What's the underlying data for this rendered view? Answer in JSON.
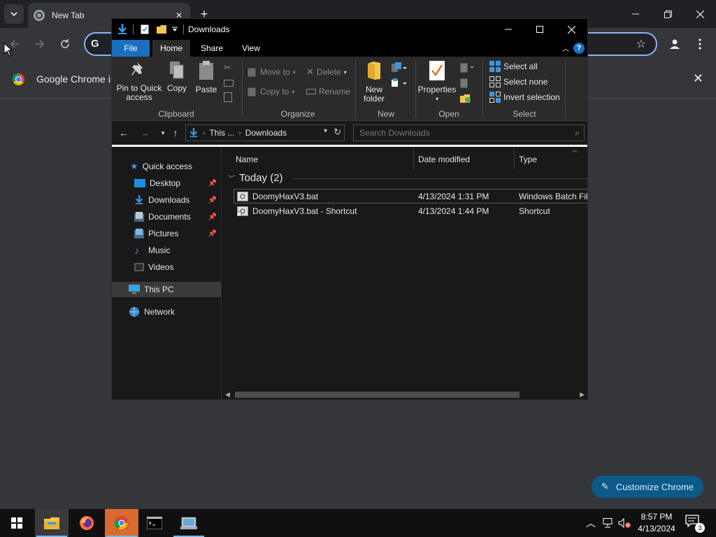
{
  "chrome": {
    "tab_title": "New Tab",
    "infobar_message": "Google Chrome isn",
    "customize_label": "Customize Chrome"
  },
  "explorer": {
    "title": "Downloads",
    "ribbon_tabs": [
      "File",
      "Home",
      "Share",
      "View"
    ],
    "clipboard": {
      "pin": "Pin to Quick access",
      "copy": "Copy",
      "paste": "Paste",
      "group": "Clipboard"
    },
    "organize": {
      "move_to": "Move to",
      "copy_to": "Copy to",
      "delete": "Delete",
      "rename": "Rename",
      "group": "Organize"
    },
    "new": {
      "new_folder": "New folder",
      "group": "New"
    },
    "open": {
      "properties": "Properties",
      "group": "Open"
    },
    "select": {
      "select_all": "Select all",
      "select_none": "Select none",
      "invert": "Invert selection",
      "group": "Select"
    },
    "address": {
      "crumb1": "This ...",
      "crumb2": "Downloads"
    },
    "search_placeholder": "Search Downloads",
    "nav": {
      "quick_access": "Quick access",
      "desktop": "Desktop",
      "downloads": "Downloads",
      "documents": "Documents",
      "pictures": "Pictures",
      "music": "Music",
      "videos": "Videos",
      "this_pc": "This PC",
      "network": "Network"
    },
    "columns": {
      "name": "Name",
      "date": "Date modified",
      "type": "Type"
    },
    "group_header": "Today (2)",
    "files": [
      {
        "name": "DoomyHaxV3.bat",
        "date": "4/13/2024 1:31 PM",
        "type": "Windows Batch File"
      },
      {
        "name": "DoomyHaxV3.bat - Shortcut",
        "date": "4/13/2024 1:44 PM",
        "type": "Shortcut"
      }
    ]
  },
  "taskbar": {
    "time": "8:57 PM",
    "date": "4/13/2024",
    "notification_count": "3"
  },
  "colors": {
    "accent": "#1a6fc0",
    "chrome_accent": "#8ab4f8",
    "customize_bg": "#0b5a88"
  }
}
